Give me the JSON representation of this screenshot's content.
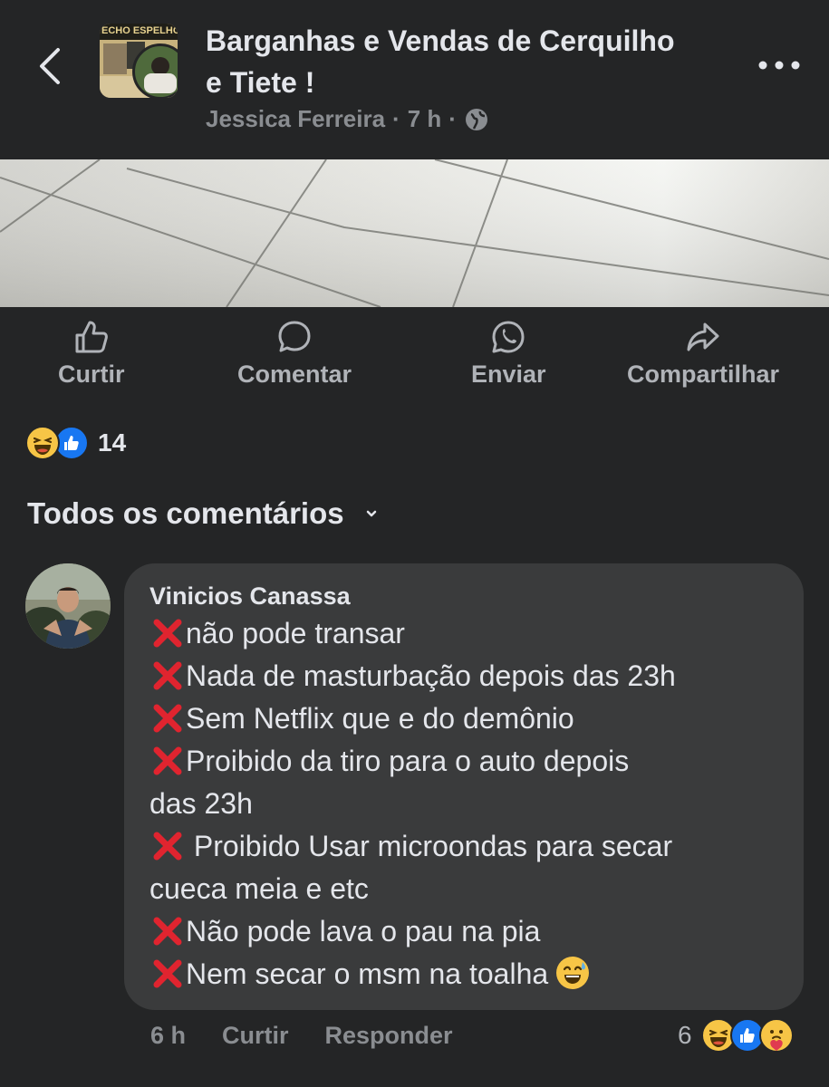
{
  "header": {
    "group_name": "Barganhas e Vendas de Cerquilho e Tiete !",
    "author": "Jessica Ferreira",
    "time": "7 h",
    "separator": "·",
    "avatar_text": "ECHO ESPELHO"
  },
  "actions": {
    "like": "Curtir",
    "comment": "Comentar",
    "send": "Enviar",
    "share": "Compartilhar"
  },
  "reactions": {
    "count": "14"
  },
  "comments_filter": {
    "label": "Todos os comentários"
  },
  "comment": {
    "author": "Vinicios Canassa",
    "lines": [
      "não pode transar",
      "Nada de masturbação depois das 23h",
      "Sem Netflix que e do demônio",
      "Proibido da tiro para o auto depois",
      "das 23h",
      " Proibido Usar microondas para secar",
      "cueca meia e etc",
      "Não pode lava o pau na pia",
      "Nem secar o msm na toalha "
    ],
    "time": "6 h",
    "like": "Curtir",
    "reply": "Responder",
    "reaction_count": "6"
  },
  "colors": {
    "background": "#242526",
    "bubble": "#3a3b3c",
    "text": "#e4e6eb",
    "muted": "#8a8d91",
    "like_blue": "#1877f2",
    "x_red": "#e0242f"
  },
  "icons": {
    "back": "chevron-left-icon",
    "more": "more-dots-icon",
    "globe": "globe-icon",
    "like": "thumbs-up-icon",
    "comment": "comment-bubble-icon",
    "send": "whatsapp-icon",
    "share": "share-arrow-icon",
    "dropdown": "chevron-down-icon",
    "cross": "cross-mark-icon"
  }
}
